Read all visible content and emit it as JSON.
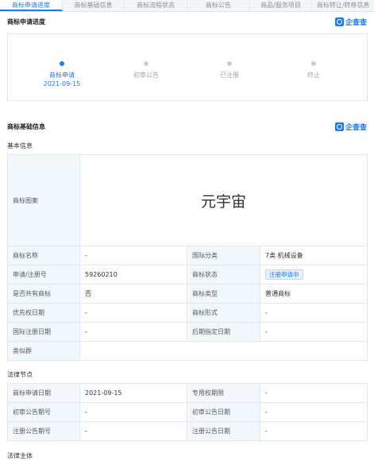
{
  "tabs": [
    {
      "label": "商标申请进度",
      "active": true
    },
    {
      "label": "商标基础信息",
      "active": false
    },
    {
      "label": "商标流程状态",
      "active": false
    },
    {
      "label": "商标公告",
      "active": false
    },
    {
      "label": "商品/服务项目",
      "active": false
    },
    {
      "label": "商标转让/转移信息",
      "active": false
    }
  ],
  "logo_text": "企查查",
  "progress": {
    "title": "商标申请进度",
    "steps": [
      {
        "label": "商标申请",
        "date": "2021-09-15",
        "active": true
      },
      {
        "label": "初审公告",
        "active": false
      },
      {
        "label": "已注册",
        "active": false
      },
      {
        "label": "终止",
        "active": false
      }
    ]
  },
  "basic": {
    "title": "商标基础信息",
    "subtitle": "基本信息",
    "image_label": "商标图案",
    "image_text": "元宇宙",
    "rows": [
      [
        {
          "k": "商标名称",
          "v": "-"
        },
        {
          "k": "国际分类",
          "v": "7类 机械设备"
        }
      ],
      [
        {
          "k": "申请/注册号",
          "v": "59260210"
        },
        {
          "k": "商标状态",
          "v": "注册申请中",
          "badge": true
        }
      ],
      [
        {
          "k": "是否共有商标",
          "v": "否"
        },
        {
          "k": "商标类型",
          "v": "普通商标"
        }
      ],
      [
        {
          "k": "优先权日期",
          "v": "-"
        },
        {
          "k": "商标形式",
          "v": "-"
        }
      ],
      [
        {
          "k": "国际注册日期",
          "v": "-"
        },
        {
          "k": "后期指定日期",
          "v": "-"
        }
      ]
    ],
    "similar_label": "类似群",
    "similar_value": ""
  },
  "legal": {
    "subtitle": "法律节点",
    "rows": [
      [
        {
          "k": "商标申请日期",
          "v": "2021-09-15"
        },
        {
          "k": "专用权期限",
          "v": "-"
        }
      ],
      [
        {
          "k": "初审公告期号",
          "v": "-"
        },
        {
          "k": "初审公告日期",
          "v": "-"
        }
      ],
      [
        {
          "k": "注册公告期号",
          "v": "-"
        },
        {
          "k": "注册公告日期",
          "v": "-"
        }
      ]
    ]
  },
  "subject": {
    "subtitle": "法律主体"
  },
  "colors": {
    "accent": "#1a7af8",
    "key_bg": "#f3f8fd",
    "border": "#e4e7ec"
  }
}
